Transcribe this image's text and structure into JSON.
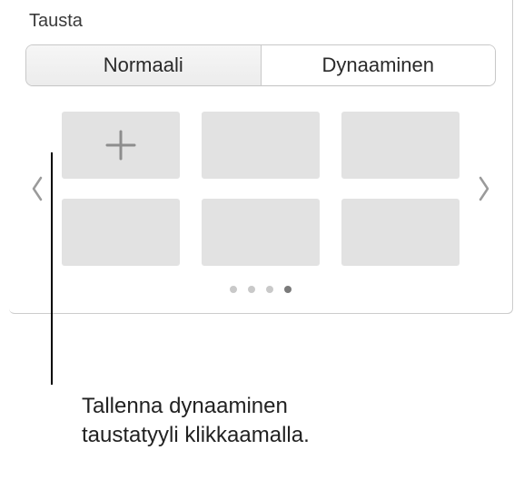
{
  "section": {
    "title": "Tausta"
  },
  "tabs": {
    "normal": "Normaali",
    "dynamic": "Dynaaminen"
  },
  "pagination": {
    "count": 4,
    "active_index": 3
  },
  "callout": {
    "text": "Tallenna dynaaminen\ntaustatyyli klikkaamalla."
  }
}
